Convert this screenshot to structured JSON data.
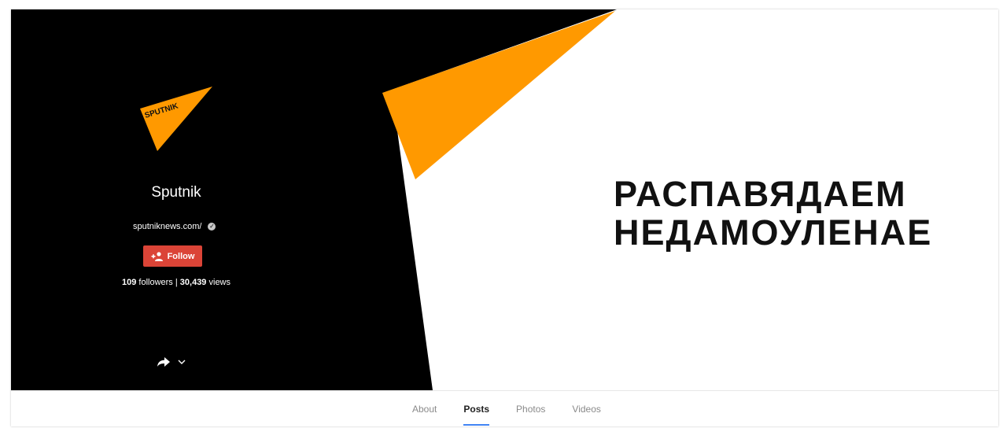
{
  "profile": {
    "name": "Sputnik",
    "logo_text": "SPUTNIK",
    "website": "sputniknews.com/",
    "follow_label": "Follow",
    "followers": "109",
    "followers_label": "followers |",
    "views": "30,439",
    "views_label": "views"
  },
  "cover": {
    "headline_line1": "РАСПАВЯДАЕМ",
    "headline_line2": "НЕДАМОУЛЕНАЕ"
  },
  "tabs": [
    {
      "label": "About",
      "active": false
    },
    {
      "label": "Posts",
      "active": true
    },
    {
      "label": "Photos",
      "active": false
    },
    {
      "label": "Videos",
      "active": false
    }
  ],
  "colors": {
    "brand_orange": "#ff9900",
    "follow_red": "#db4437",
    "tab_indicator": "#4285f4",
    "cover_black": "#000000"
  },
  "icons": [
    "sputnik-logo",
    "verified-icon",
    "add-person-icon",
    "share-icon",
    "chevron-down-icon"
  ]
}
